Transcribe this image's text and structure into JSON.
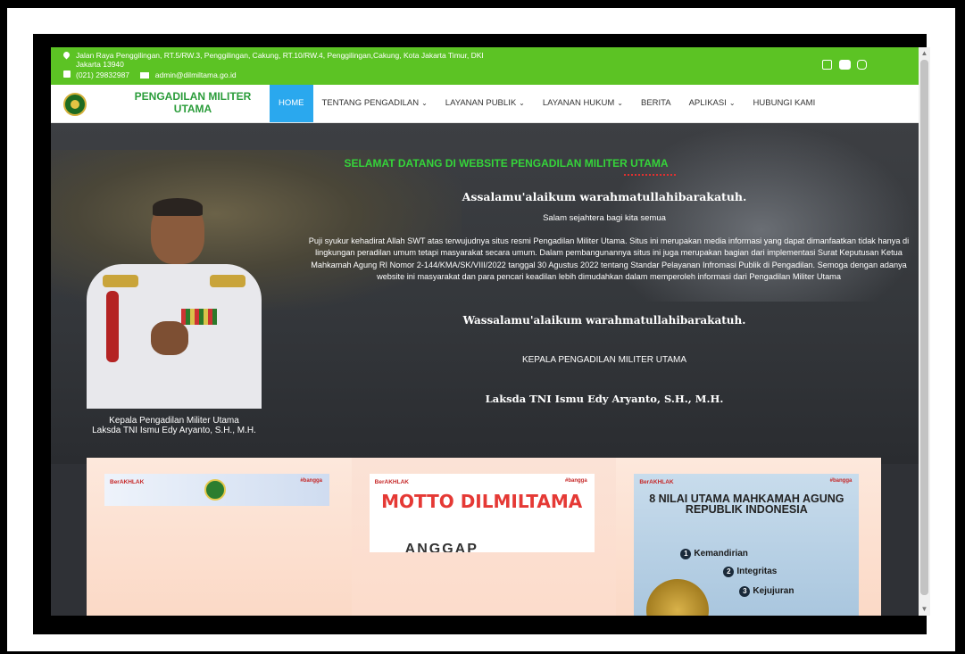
{
  "topbar": {
    "address": "Jalan Raya Penggilingan, RT.5/RW.3, Penggilingan, Cakung, RT.10/RW.4, Penggilingan,Cakung, Kota Jakarta Timur, DKI Jakarta 13940",
    "phone": "(021) 29832987",
    "email": "admin@dilmiltama.go.id"
  },
  "brand": {
    "name": "PENGADILAN MILITER UTAMA"
  },
  "nav": [
    {
      "label": "HOME",
      "caret": false
    },
    {
      "label": "TENTANG PENGADILAN",
      "caret": true
    },
    {
      "label": "LAYANAN PUBLIK",
      "caret": true
    },
    {
      "label": "LAYANAN HUKUM",
      "caret": true
    },
    {
      "label": "BERITA",
      "caret": false
    },
    {
      "label": "APLIKASI",
      "caret": true
    },
    {
      "label": "HUBUNGI KAMI",
      "caret": false
    }
  ],
  "hero": {
    "welcome": "SELAMAT DATANG DI WEBSITE PENGADILAN MILITER UTAMA",
    "salam": "Assalamu'alaikum warahmatullahibarakatuh.",
    "salam2": "Salam sejahtera bagi kita semua",
    "body": "Puji syukur kehadirat Allah SWT atas terwujudnya situs resmi Pengadilan Militer Utama. Situs ini merupakan media informasi yang dapat dimanfaatkan tidak hanya di lingkungan peradilan umum tetapi masyarakat secara umum. Dalam pembangunannya situs ini juga merupakan bagian dari implementasi Surat Keputusan Ketua Mahkamah Agung RI Nomor 2-144/KMA/SK/VIII/2022 tanggal 30 Agustus 2022 tentang Standar Pelayanan Infromasi Publik di Pengadilan. Semoga dengan adanya website ini masyarakat dan para pencari keadilan lebih dimudahkan dalam memperoleh informasi dari Pengadilan Militer Utama",
    "wassalam": "Wassalamu'alaikum warahmatullahibarakatuh.",
    "kepala_title": "KEPALA PENGADILAN MILITER UTAMA",
    "kepala_name": "Laksda TNI Ismu Edy Aryanto, S.H., M.H.",
    "caption_line1": "Kepala Pengadilan Militer Utama",
    "caption_line2": "Laksda TNI Ismu Edy Aryanto, S.H., M.H."
  },
  "cards": {
    "tag": "BerAKHLAK",
    "tag2": "#bangga",
    "motto": "MOTTO DILMILTAMA",
    "motto_sub": "ANGGAP",
    "nilai_title": "8 NILAI UTAMA MAHKAMAH AGUNG REPUBLIK INDONESIA",
    "nilai": [
      {
        "n": "1",
        "label": "Kemandirian"
      },
      {
        "n": "2",
        "label": "Integritas"
      },
      {
        "n": "3",
        "label": "Kejujuran"
      }
    ]
  },
  "colors": {
    "topbar": "#5cc324",
    "active_nav": "#2aa8ee",
    "welcome": "#35d43a"
  }
}
